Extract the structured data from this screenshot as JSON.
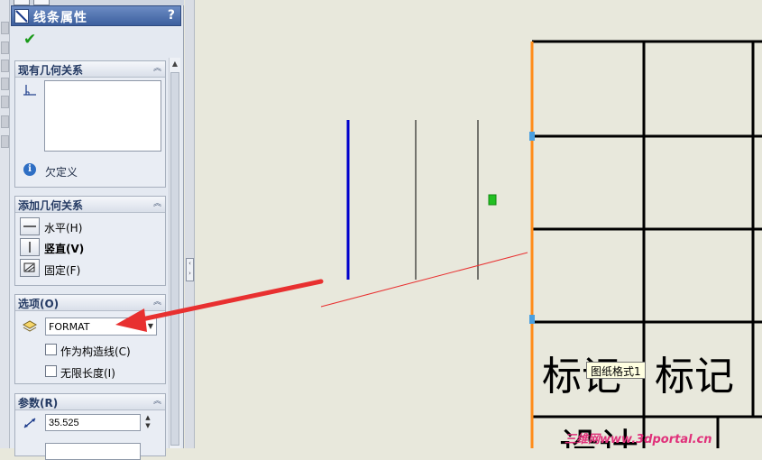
{
  "panel": {
    "title": "线条属性",
    "help": "?",
    "existing_relations": {
      "header": "现有几何关系",
      "status": "欠定义"
    },
    "add_relations": {
      "header": "添加几何关系",
      "horizontal": "水平(H)",
      "vertical": "竖直(V)",
      "fixed": "固定(F)"
    },
    "options": {
      "header": "选项(O)",
      "layer_value": "FORMAT",
      "construction": "作为构造线(C)",
      "infinite_length": "无限长度(I)"
    },
    "parameters": {
      "header": "参数(R)",
      "length_value": "35.525"
    }
  },
  "drawing": {
    "title_block_text_1": "标记",
    "title_block_text_2": "标记",
    "title_block_text_3": "设计"
  },
  "tooltip": "图纸格式1",
  "watermark": "三维网www.3dportal.cn",
  "colors": {
    "title_bar": "#3c5f9e",
    "selected_line": "#0000cc",
    "format_border": "#ff8c1a",
    "arrow": "#e83030",
    "endpoint_marker": "#22c022"
  }
}
